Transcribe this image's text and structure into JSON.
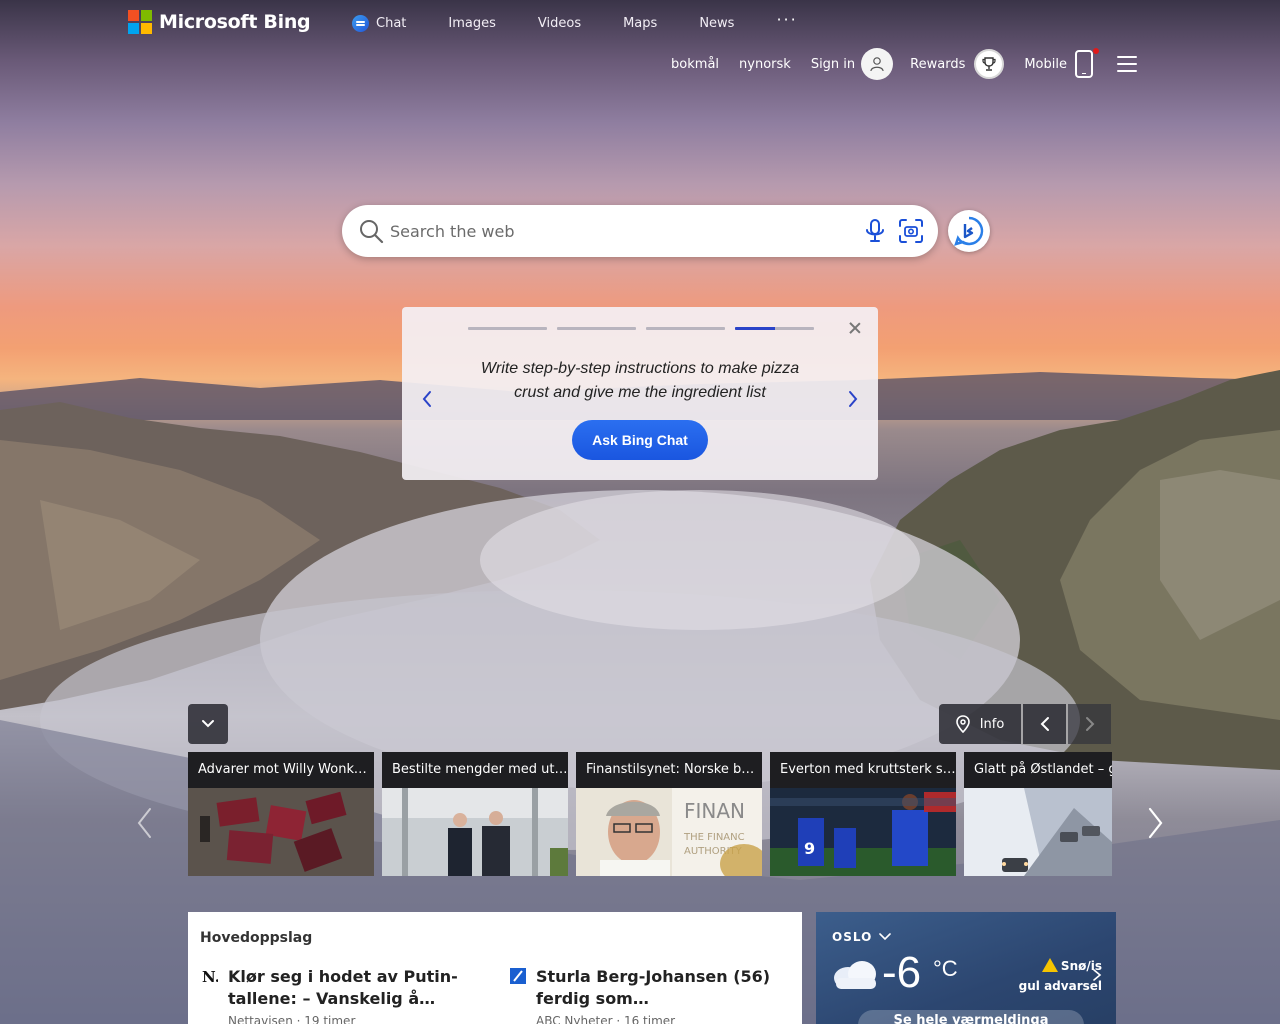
{
  "brand": {
    "name": "Microsoft Bing"
  },
  "nav": {
    "chat": "Chat",
    "images": "Images",
    "videos": "Videos",
    "maps": "Maps",
    "news": "News",
    "more": "···"
  },
  "header_right": {
    "lang1": "bokmål",
    "lang2": "nynorsk",
    "signin": "Sign in",
    "rewards": "Rewards",
    "mobile": "Mobile"
  },
  "search": {
    "placeholder": "Search the web"
  },
  "prompt_card": {
    "progress_segments": 4,
    "active_segment": 4,
    "text": "Write step-by-step instructions to make pizza crust and give me the ingredient list",
    "button": "Ask Bing Chat"
  },
  "image_controls": {
    "info": "Info"
  },
  "news_strip": [
    {
      "caption": "Advarer mot Willy Wonka-sjokolade"
    },
    {
      "caption": "Bestilte mengder med utstyr"
    },
    {
      "caption": "Finanstilsynet: Norske banker"
    },
    {
      "caption": "Everton med kruttsterk seier"
    },
    {
      "caption": "Glatt på Østlandet – glatte veier"
    }
  ],
  "headlines": {
    "title": "Hovedoppslag",
    "stories": [
      {
        "source_icon": "nettavisen-logo",
        "title": "Klør seg i hodet av Putin-tallene: – Vanskelig å…",
        "meta": "Nettavisen · 19 timer"
      },
      {
        "source_icon": "abc-nyheter-logo",
        "title": "Sturla Berg-Johansen (56) ferdig som…",
        "meta": "ABC Nyheter · 16 timer"
      }
    ]
  },
  "weather": {
    "city": "OSLO",
    "temp": "-6",
    "unit": "°C",
    "warning_line1": "Snø/is",
    "warning_line2": "gul advarsel",
    "forecast_button": "Se hele værmeldinga"
  },
  "colors": {
    "accent": "#1a56e0",
    "progress_active": "#2a43c8",
    "warning": "#f5c400",
    "notification": "#e01a1a"
  }
}
